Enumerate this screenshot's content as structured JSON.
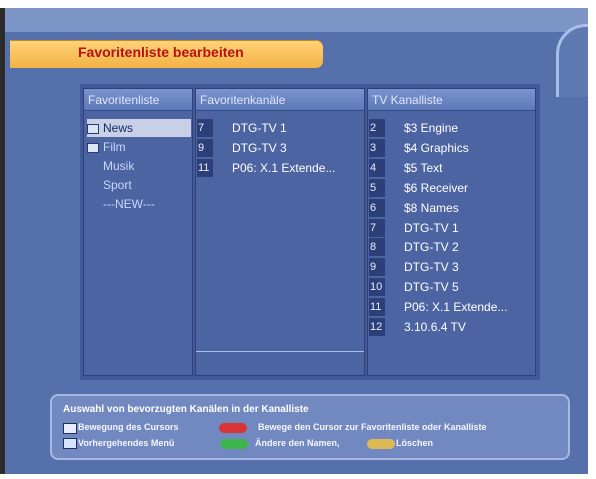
{
  "title": "Favoritenliste bearbeiten",
  "columns": {
    "favorites_header": "Favoritenliste",
    "fav_channels_header": "Favoritenkanäle",
    "tv_list_header": "TV Kanalliste"
  },
  "favorites": [
    {
      "label": "News",
      "selected": true
    },
    {
      "label": "Film",
      "selected": false
    },
    {
      "label": "Musik",
      "selected": false
    },
    {
      "label": "Sport",
      "selected": false
    },
    {
      "label": "---NEW---",
      "selected": false
    }
  ],
  "favorite_channels": [
    {
      "num": "7",
      "name": "DTG-TV 1"
    },
    {
      "num": "9",
      "name": "DTG-TV 3"
    },
    {
      "num": "11",
      "name": "P06: X.1 Extende..."
    }
  ],
  "tv_channels": [
    {
      "num": "2",
      "name": "$3 Engine"
    },
    {
      "num": "3",
      "name": "$4 Graphics"
    },
    {
      "num": "4",
      "name": "$5 Text"
    },
    {
      "num": "5",
      "name": "$6 Receiver"
    },
    {
      "num": "6",
      "name": "$8 Names"
    },
    {
      "num": "7",
      "name": "DTG-TV 1"
    },
    {
      "num": "8",
      "name": "DTG-TV 2"
    },
    {
      "num": "9",
      "name": "DTG-TV 3"
    },
    {
      "num": "10",
      "name": "DTG-TV 5"
    },
    {
      "num": "11",
      "name": "P06: X.1 Extende..."
    },
    {
      "num": "12",
      "name": "3.10.6.4 TV"
    }
  ],
  "help": {
    "line1": "Auswahl von bevorzugten Kanälen in der Kanalliste",
    "move_cursor": "Bewegung des Cursors",
    "move_to_list": "Bewege den Cursor zur Favoritenliste oder Kanalliste",
    "menu_prefix": "MENU",
    "previous_menu": "Vorhergehendes Menü",
    "rename": "Ändere den Namen,",
    "delete": "Löschen"
  },
  "colors": {
    "title_text": "#b51212",
    "title_bar": "#f3b245",
    "background": "#5570ab",
    "red_key": "#d83436",
    "green_key": "#3cb64c",
    "yellow_key": "#dbba55"
  }
}
